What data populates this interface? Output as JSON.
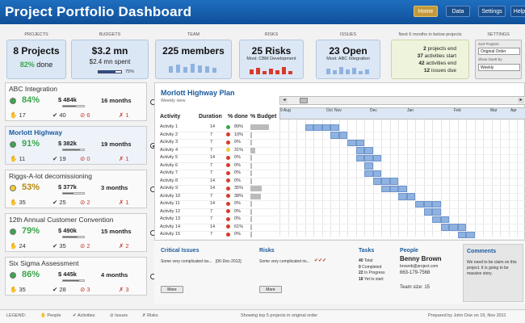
{
  "app_title": "Project Portfolio Dashboard",
  "nav": {
    "home": "Home",
    "data": "Data",
    "settings": "Settings",
    "help": "Help"
  },
  "summary": {
    "projects": {
      "label": "PROJECTS",
      "value": "8 Projects",
      "done_pct": "82%",
      "done_label": "done"
    },
    "budgets": {
      "label": "BUDGETS",
      "value": "$3.2 mn",
      "spent": "$2.4 mn spent",
      "spent_pct": "75%",
      "spent_fraction": 0.75
    },
    "team": {
      "label": "TEAM",
      "value": "225 members"
    },
    "risks": {
      "label": "RISKS",
      "value": "25 Risks",
      "sub": "Most: CBM Development"
    },
    "issues": {
      "label": "ISSUES",
      "value": "23 Open",
      "sub": "Most: ABC Integration"
    },
    "next6": {
      "label": "Next 6 months in below projects",
      "rows": [
        {
          "num": "2",
          "text": "projects end"
        },
        {
          "num": "37",
          "text": "activities start"
        },
        {
          "num": "42",
          "text": "activities end"
        },
        {
          "num": "12",
          "text": "issues due"
        }
      ]
    },
    "settings": {
      "label": "SETTINGS",
      "sort_label": "Sort Projects",
      "sort_value": "Original Order",
      "gantt_label": "Show Gantt by",
      "gantt_value": "Weekly"
    }
  },
  "projects": [
    {
      "name": "ABC Integration",
      "status": "green",
      "done": "84%",
      "budget": "$ 484k",
      "budget_fraction": 0.6,
      "months": "16 months",
      "people": "17",
      "activities": "40",
      "issues": "6",
      "risks": "1",
      "selected": false
    },
    {
      "name": "Morlott Highway",
      "status": "green",
      "done": "91%",
      "budget": "$ 382k",
      "budget_fraction": 0.8,
      "months": "19 months",
      "people": "11",
      "activities": "19",
      "issues": "0",
      "risks": "1",
      "selected": true
    },
    {
      "name": "Riggs-A-lot decomissioning",
      "status": "yellow",
      "done": "53%",
      "budget": "$ 377k",
      "budget_fraction": 0.5,
      "months": "3 months",
      "people": "35",
      "activities": "25",
      "issues": "2",
      "risks": "1",
      "selected": false
    },
    {
      "name": "12th Annual Customer Convention",
      "status": "green",
      "done": "79%",
      "budget": "$ 490k",
      "budget_fraction": 0.7,
      "months": "15 months",
      "people": "24",
      "activities": "35",
      "issues": "2",
      "risks": "2",
      "selected": false
    },
    {
      "name": "Six Sigma Assessment",
      "status": "green",
      "done": "86%",
      "budget": "$ 445k",
      "budget_fraction": 0.75,
      "months": "4 months",
      "people": "35",
      "activities": "28",
      "issues": "3",
      "risks": "3",
      "selected": false
    }
  ],
  "plan": {
    "title": "Morlott Highway Plan",
    "subtitle": "Weekly view",
    "headers": {
      "activity": "Activity",
      "duration": "Duration",
      "pct_done": "% done",
      "pct_budget": "% Budget"
    },
    "months": [
      "9 Aug",
      "Oct",
      "Nov",
      "Dec",
      "Jan",
      "Feb",
      "Mar",
      "Apr"
    ],
    "rows": [
      {
        "name": "Activity 1",
        "duration": "14",
        "status": "green",
        "done": "89%",
        "budget": 0.9,
        "start": 3,
        "len": 4
      },
      {
        "name": "Activity 2",
        "duration": "7",
        "status": "red",
        "done": "10%",
        "budget": 0.05,
        "start": 6,
        "len": 2
      },
      {
        "name": "Activity 3",
        "duration": "7",
        "status": "red",
        "done": "0%",
        "budget": 0.05,
        "start": 8,
        "len": 2
      },
      {
        "name": "Activity 4",
        "duration": "7",
        "status": "yellow",
        "done": "31%",
        "budget": 0.25,
        "start": 9,
        "len": 2
      },
      {
        "name": "Activity 5",
        "duration": "14",
        "status": "red",
        "done": "0%",
        "budget": 0.05,
        "start": 9,
        "len": 3
      },
      {
        "name": "Activity 6",
        "duration": "7",
        "status": "red",
        "done": "0%",
        "budget": 0.05,
        "start": 10,
        "len": 1
      },
      {
        "name": "Activity 7",
        "duration": "7",
        "status": "red",
        "done": "0%",
        "budget": 0.05,
        "start": 10,
        "len": 2
      },
      {
        "name": "Activity 8",
        "duration": "14",
        "status": "red",
        "done": "0%",
        "budget": 0.05,
        "start": 11,
        "len": 3
      },
      {
        "name": "Activity 9",
        "duration": "14",
        "status": "red",
        "done": "35%",
        "budget": 0.55,
        "start": 12,
        "len": 3
      },
      {
        "name": "Activity 10",
        "duration": "7",
        "status": "red",
        "done": "38%",
        "budget": 0.5,
        "start": 14,
        "len": 2
      },
      {
        "name": "Activity 11",
        "duration": "14",
        "status": "red",
        "done": "0%",
        "budget": 0.05,
        "start": 16,
        "len": 3
      },
      {
        "name": "Activity 12",
        "duration": "7",
        "status": "red",
        "done": "0%",
        "budget": 0.05,
        "start": 17,
        "len": 2
      },
      {
        "name": "Activity 13",
        "duration": "7",
        "status": "red",
        "done": "0%",
        "budget": 0.05,
        "start": 18,
        "len": 2
      },
      {
        "name": "Activity 14",
        "duration": "14",
        "status": "red",
        "done": "61%",
        "budget": 0.05,
        "start": 19,
        "len": 3
      },
      {
        "name": "Activity 15",
        "duration": "7",
        "status": "red",
        "done": "0%",
        "budget": 0.05,
        "start": 21,
        "len": 2
      }
    ]
  },
  "bottom": {
    "critical_title": "Critical Issues",
    "critical_text": "Some very complicated iss...",
    "critical_date": "[06-Dec-2012]",
    "risks_title": "Risks",
    "risks_text": "Some very complicated ris...",
    "more": "More",
    "tasks_title": "Tasks",
    "tasks": [
      {
        "num": "40",
        "text": "Total"
      },
      {
        "num": "0",
        "text": "Completed"
      },
      {
        "num": "22",
        "text": "In Progress"
      },
      {
        "num": "18",
        "text": "Yet to start"
      }
    ],
    "people_title": "People",
    "person_name": "Benny Brown",
    "person_email": "brownb@project.com",
    "person_phone": "663-179-7568",
    "team_size": "Team size: 15",
    "comments_title": "Comments",
    "comments_text": "We need to be claim on this project. It is going to be massive story."
  },
  "footer": {
    "legend": "LEGEND:",
    "people": "People",
    "activities": "Activities",
    "issues": "Issues",
    "risks": "Risks",
    "center": "Showing top 5 projects in original order",
    "right": "Prepared by John Doe on 19, Nov 2011"
  },
  "colors": {
    "accent": "#1a5a9c",
    "topbar": "#1f6fbf",
    "green": "#3aa64b",
    "yellow": "#f2cc33",
    "red": "#d9392a",
    "gantt": "#8fb2e0"
  }
}
